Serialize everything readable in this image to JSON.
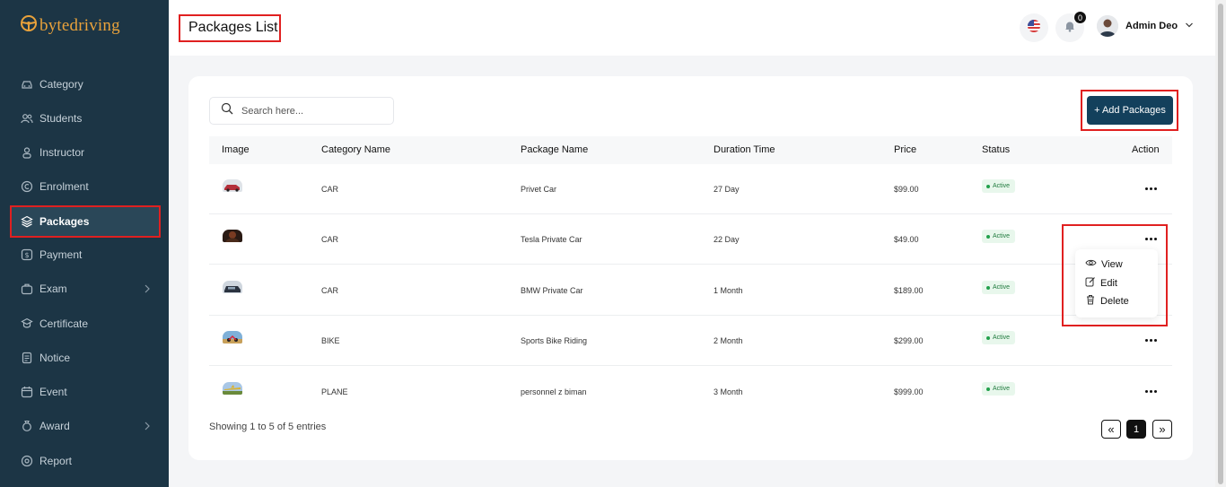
{
  "brand": {
    "name": "bytedriving"
  },
  "sidebar": {
    "items": [
      {
        "label": "Category",
        "icon": "car-icon"
      },
      {
        "label": "Students",
        "icon": "users-icon"
      },
      {
        "label": "Instructor",
        "icon": "user-icon"
      },
      {
        "label": "Enrolment",
        "icon": "copyright-icon"
      },
      {
        "label": "Packages",
        "icon": "layers-icon",
        "active": true
      },
      {
        "label": "Payment",
        "icon": "dollar-icon"
      },
      {
        "label": "Exam",
        "icon": "briefcase-icon",
        "expandable": true
      },
      {
        "label": "Certificate",
        "icon": "certificate-icon"
      },
      {
        "label": "Notice",
        "icon": "document-icon"
      },
      {
        "label": "Event",
        "icon": "calendar-icon"
      },
      {
        "label": "Award",
        "icon": "award-icon",
        "expandable": true
      },
      {
        "label": "Report",
        "icon": "report-icon"
      }
    ]
  },
  "header": {
    "title": "Packages List",
    "notification_count": "0",
    "user_name": "Admin Deo"
  },
  "search": {
    "placeholder": "Search here..."
  },
  "toolbar": {
    "add_label": "+ Add Packages"
  },
  "table": {
    "columns": [
      "Image",
      "Category Name",
      "Package Name",
      "Duration Time",
      "Price",
      "Status",
      "Action"
    ],
    "rows": [
      {
        "category": "CAR",
        "package": "Privet Car",
        "duration": "27 Day",
        "price": "$99.00",
        "status": "Active"
      },
      {
        "category": "CAR",
        "package": "Tesla Private Car",
        "duration": "22 Day",
        "price": "$49.00",
        "status": "Active"
      },
      {
        "category": "CAR",
        "package": "BMW Private Car",
        "duration": "1 Month",
        "price": "$189.00",
        "status": "Active"
      },
      {
        "category": "BIKE",
        "package": "Sports Bike Riding",
        "duration": "2 Month",
        "price": "$299.00",
        "status": "Active"
      },
      {
        "category": "PLANE",
        "package": "personnel z biman",
        "duration": "3 Month",
        "price": "$999.00",
        "status": "Active"
      }
    ]
  },
  "action_menu": {
    "view": "View",
    "edit": "Edit",
    "delete": "Delete"
  },
  "pagination": {
    "info": "Showing 1 to 5 of 5 entries",
    "prev": "«",
    "current": "1",
    "next": "»"
  },
  "colors": {
    "sidebar_bg": "#1c3545",
    "brand": "#e9a23b",
    "primary_button": "#13405c",
    "highlight_frame": "#e02020",
    "active_badge": "#22a04b"
  }
}
